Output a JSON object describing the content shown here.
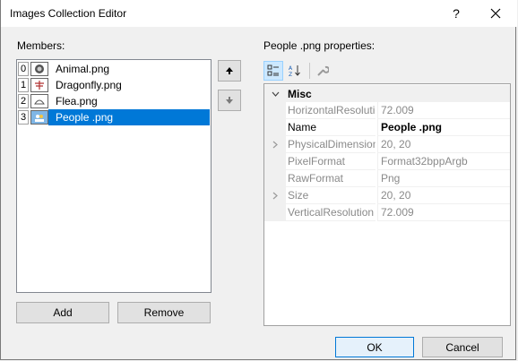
{
  "window": {
    "title": "Images Collection Editor",
    "help_label": "?",
    "close_label": "✕"
  },
  "members": {
    "label": "Members:",
    "items": [
      {
        "index": "0",
        "name": "Animal.png",
        "icon": "animal-image-icon"
      },
      {
        "index": "1",
        "name": "Dragonfly.png",
        "icon": "dragonfly-image-icon"
      },
      {
        "index": "2",
        "name": "Flea.png",
        "icon": "flea-image-icon"
      },
      {
        "index": "3",
        "name": "People .png",
        "icon": "people-image-icon",
        "selected": true
      }
    ],
    "add_label": "Add",
    "remove_label": "Remove"
  },
  "properties": {
    "label": "People .png properties:",
    "toolbar": [
      "categorized-icon",
      "alphabetical-icon",
      "property-pages-icon"
    ],
    "category": "Misc",
    "rows": [
      {
        "name": "HorizontalResolution",
        "value": "72.009",
        "expandable": false,
        "editable": false
      },
      {
        "name": "Name",
        "value": "People .png",
        "expandable": false,
        "editable": true
      },
      {
        "name": "PhysicalDimension",
        "value": "20, 20",
        "expandable": true,
        "editable": false
      },
      {
        "name": "PixelFormat",
        "value": "Format32bppArgb",
        "expandable": false,
        "editable": false
      },
      {
        "name": "RawFormat",
        "value": "Png",
        "expandable": false,
        "editable": false
      },
      {
        "name": "Size",
        "value": "20, 20",
        "expandable": true,
        "editable": false
      },
      {
        "name": "VerticalResolution",
        "value": "72.009",
        "expandable": false,
        "editable": false
      }
    ]
  },
  "footer": {
    "ok_label": "OK",
    "cancel_label": "Cancel"
  },
  "colors": {
    "selection": "#0078d7",
    "disabled_text": "#8a8a8a"
  }
}
